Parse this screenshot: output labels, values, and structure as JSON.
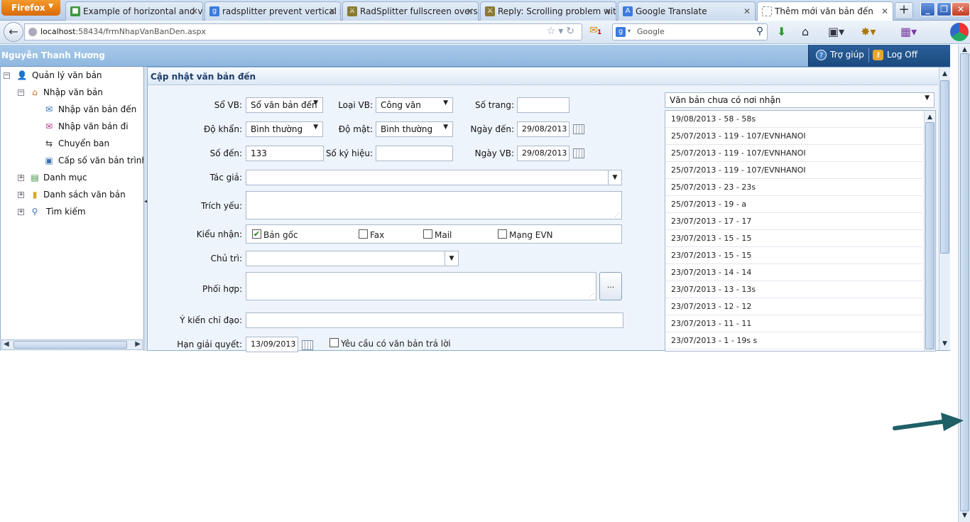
{
  "browser": {
    "menu_button": "Firefox",
    "tabs": [
      {
        "title": "Example of horizontal and ve..."
      },
      {
        "title": "radsplitter prevent vertical sc..."
      },
      {
        "title": "RadSplitter fullscreen oversiz..."
      },
      {
        "title": "Reply: Scrolling problem with ..."
      },
      {
        "title": "Google Translate"
      },
      {
        "title": "Thêm mới văn bản đến"
      }
    ],
    "url_host": "localhost",
    "url_rest": ":58434/frmNhapVanBanDen.aspx",
    "search_placeholder": "Google",
    "mail_count": "1"
  },
  "header": {
    "user_name": "Nguyễn Thanh Hương",
    "help_label": "Trợ giúp",
    "logoff_label": "Log Off"
  },
  "tree": {
    "root": "Quản lý văn bản",
    "group1": "Nhập văn bản",
    "children": [
      "Nhập văn bản đến",
      "Nhập văn bản đi",
      "Chuyển ban",
      "Cấp số văn bản trình ký"
    ],
    "danh_muc": "Danh mục",
    "danh_sach": "Danh sách văn bản",
    "tim_kiem": "Tìm kiếm"
  },
  "form": {
    "panel_title": "Cập nhật văn bản đến",
    "so_vb_label": "Sổ VB:",
    "so_vb_value": "Sổ văn bản đến",
    "loai_vb_label": "Loại VB:",
    "loai_vb_value": "Công văn",
    "so_trang_label": "Số trang:",
    "so_trang_value": "",
    "do_khan_label": "Độ khẩn:",
    "do_khan_value": "Bình thường",
    "do_mat_label": "Độ mật:",
    "do_mat_value": "Bình thường",
    "ngay_den_label": "Ngày đến:",
    "ngay_den_value": "29/08/2013",
    "so_den_label": "Số đến:",
    "so_den_value": "133",
    "so_ky_hieu_label": "Số ký hiệu:",
    "so_ky_hieu_value": "",
    "ngay_vb_label": "Ngày VB:",
    "ngay_vb_value": "29/08/2013",
    "tac_gia_label": "Tác giả:",
    "tac_gia_value": "",
    "trich_yeu_label": "Trích yếu:",
    "kieu_nhan_label": "Kiểu nhận:",
    "kieu_nhan_options": [
      {
        "label": "Bản gốc",
        "checked": true
      },
      {
        "label": "Fax",
        "checked": false
      },
      {
        "label": "Mail",
        "checked": false
      },
      {
        "label": "Mạng EVN",
        "checked": false
      }
    ],
    "chu_tri_label": "Chủ trì:",
    "phoi_hop_label": "Phối hợp:",
    "phoi_hop_button": "...",
    "y_kien_label": "Ý kiến chỉ đạo:",
    "han_giai_quyet_label": "Hạn giải quyết:",
    "han_giai_quyet_value": "13/09/2013",
    "yeu_cau_label": "Yêu cầu có văn bản trả lời",
    "yeu_cau_checked": false
  },
  "right_list": {
    "filter_value": "Văn bản chưa có nơi nhận",
    "items": [
      "19/08/2013 - 58 - 58s",
      "25/07/2013 - 119 - 107/EVNHANOI",
      "25/07/2013 - 119 - 107/EVNHANOI",
      "25/07/2013 - 119 - 107/EVNHANOI",
      "25/07/2013 - 23 - 23s",
      "25/07/2013 - 19 - a",
      "23/07/2013 - 17 - 17",
      "23/07/2013 - 15 - 15",
      "23/07/2013 - 15 - 15",
      "23/07/2013 - 14 - 14",
      "23/07/2013 - 13 - 13s",
      "23/07/2013 - 12 - 12",
      "23/07/2013 - 11 - 11",
      "23/07/2013 - 1 - 19s s"
    ]
  },
  "colors": {
    "header_bar": "#9fc3e6",
    "logoff_bar": "#1f4f86",
    "annotation_arrow": "#1f5f66"
  }
}
